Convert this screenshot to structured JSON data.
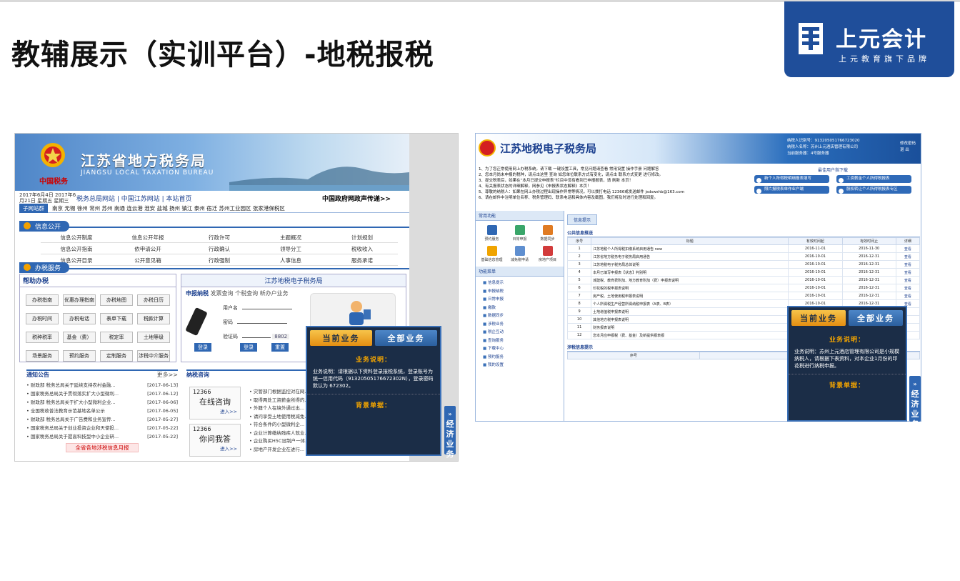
{
  "slide": {
    "title": "教辅展示（实训平台）-地税报税",
    "logo_brand": "上元会计",
    "logo_sub": "上元教育旗下品牌"
  },
  "left_site": {
    "header_cn": "江苏省地方税务局",
    "header_en": "JIANGSU LOCAL TAXATION BUREAU",
    "emblem_caption": "中国税务",
    "date_line": "2017年6月4日 2017年6月21日 星期五 星期三",
    "nav_links": "税务总局网站 | 中国江苏网站 | 本站首页",
    "nav_right": "中国政府网政声传递>>",
    "subnav_tag": "子网站群",
    "subnav_items": "南京  无锡  徐州  常州  苏州  南通  连云港  淮安  盐城  扬州  镇江  泰州  宿迁    苏州工业园区    张家港保税区",
    "info_title": "信息公开",
    "info_items": [
      "信息公开制度",
      "信息公开年报",
      "行政许可",
      "主题概况",
      "计划规划",
      "信息公开指南",
      "依申请公开",
      "行政确认",
      "领导分工",
      "税收收入",
      "信息公开目录",
      "公开意见箱",
      "行政强制",
      "人事信息",
      "服务承诺"
    ],
    "service_title": "办税服务",
    "help_title": "帮助办税",
    "help_buttons": [
      "办税指南",
      "优惠办理指南",
      "办税地图",
      "办税日历",
      "办税时间",
      "办税电话",
      "表单下载",
      "税款计算",
      "税种税率",
      "基金（费）",
      "税定率",
      "土地等级",
      "场景服务",
      "预约服务",
      "定制服务",
      "涉税中介服务"
    ],
    "login_title": "江苏地税电子税务局",
    "login_tabs": [
      "申报纳税",
      "发票查询",
      "个税查询",
      "新办户业务"
    ],
    "user_label": "用户名",
    "pwd_label": "密码",
    "captcha_label": "验证码",
    "captcha_value": "8802",
    "login_btn": "登录",
    "reset_btn": "重置",
    "cert_btn": "登录",
    "notice_title": "通知公告",
    "notice_more": "更多>>",
    "notices": [
      {
        "t": "• 财政部 税务总局关于延续支持农村金融...",
        "d": "[2017-06-13]"
      },
      {
        "t": "• 国家税务总局关于贯彻落实扩大小型微利...",
        "d": "[2017-06-12]"
      },
      {
        "t": "• 财政部 税务总局关于扩大小型微利企业...",
        "d": "[2017-06-06]"
      },
      {
        "t": "• 全国税收普法教育示范基地名单公示",
        "d": "[2017-06-05]"
      },
      {
        "t": "• 财政部 税务总局关于广告费和业务宣传...",
        "d": "[2017-05-27]"
      },
      {
        "t": "• 国家税务总局关于创业投资企业和天使投...",
        "d": "[2017-05-22]"
      },
      {
        "t": "• 国家税务总局关于提高科技型中小企业研...",
        "d": "[2017-05-22]"
      }
    ],
    "notice_footer": "全省各地涉税信息月报",
    "consult_title": "纳税咨询",
    "consult_box1_num": "12366",
    "consult_box1_text": "在线咨询",
    "consult_box2_num": "12366",
    "consult_box2_text": "你问我答",
    "consult_enter": "进入>>",
    "consult_items": [
      "• 灾管部门根据监控对在网...",
      "• 取得两处工资薪金所得的...",
      "• 外籍个人在境外通过出...",
      "• 请问享受土地使用税减免...",
      "• 符合条件的小型微利企...",
      "• 企业计算缴纳残疾人就业...",
      "• 企业购买H5C设制户一体...",
      "• 房地产开发企业在进行..."
    ]
  },
  "popup_left": {
    "tab_current": "当前业务",
    "tab_all": "全部业务",
    "desc_title": "业务说明：",
    "desc_body": "业务说明：请根据以下资料登录报税系统，登录账号为统一信用代码（91320505176672302N），登录密码默认为 672302。",
    "bg_title": "背景单据："
  },
  "side_tab": "经济业务",
  "right_site": {
    "header": "江苏地税电子税务局",
    "acct_lines": [
      "纳税人识别号：913205051766723020",
      "纳税人名称：苏州上元酒店管理有限公司",
      "当前服务器：4号服务器"
    ],
    "acct_links": [
      "修改密码",
      "退 出"
    ],
    "tips": [
      "1、为了您正常使用网上办税系统，请下载 一键设置工具，常见问题请查看 常用设置 操作手册 问题解答",
      "2、您本月尚未申报的税种，请点击这里 查询    如您单位联系方式有变化，请点击 联系方式变更 进行修改。",
      "3、提交税表后，如果在“本月已提交申报表”栏目中没有看到已申报报表，请 刷新 本页！",
      "4、有关报表状态的详细解释，网参见《申报表状态解释》本页！",
      "5、尊敬的纳税人：如果在网上办税过程出现操作异常等情况，可以拨打电话 12366或发送邮件 jsdswshb@163.com",
      "6、请在邮件中注明单位名称、税务管理码、联系电话和具体内容及截图，我们将及时进行处理和回复。"
    ],
    "guide_title": "最佳用户指下载",
    "guide_items": [
      "新个人所得税明细报表填写",
      "工资薪金个人所得税报表",
      "照片报税表单作业户端",
      "股权转让个人所得税报表专区"
    ],
    "left_menu_title": "常用功能",
    "left_icons": [
      "预约服务",
      "日常申报",
      "数据同步",
      "基础信息管理",
      "减免税申请",
      "房地产项目"
    ],
    "menu_title": "功能菜单",
    "menu_items": [
      "信息提示",
      "申报纳税",
      "日常申报",
      "缴款",
      "数据同步",
      "涉税业务",
      "税企互动",
      "查询服务",
      "下载中心",
      "预约服务",
      "我的设置"
    ],
    "tab_label": "信息提示",
    "public_title": "公共信息推送",
    "headers": [
      "序号",
      "标题",
      "有效时间起",
      "有效时间止",
      "详细"
    ],
    "rows": [
      [
        "1",
        "江苏地税个人所得税扣缴系统启用通告 new",
        "2016-11-01",
        "2016-11-30",
        "查看"
      ],
      [
        "2",
        "江苏省地方税务电子税务局启用通告",
        "2016-10-01",
        "2016-12-31",
        "查看"
      ],
      [
        "3",
        "江苏地税电子税务局总体说明",
        "2016-10-01",
        "2016-12-31",
        "查看"
      ],
      [
        "4",
        "本月已填写申报表【状态】判别明",
        "2016-10-01",
        "2016-12-31",
        "查看"
      ],
      [
        "5",
        "城建税、教育费附加、地方教育附加（费）申报表说明",
        "2016-10-01",
        "2016-12-31",
        "查看"
      ],
      [
        "6",
        "印花税的税申报表说明",
        "2016-10-01",
        "2016-12-31",
        "查看"
      ],
      [
        "7",
        "房产税、土地使用税申报表说明",
        "2016-10-01",
        "2016-12-31",
        "查看"
      ],
      [
        "8",
        "个人所得税生产经营所得纳税申报表（A表、B表）",
        "2016-10-01",
        "2016-12-31",
        "查看"
      ],
      [
        "9",
        "土地增值税申报表说明",
        "",
        "",
        ""
      ],
      [
        "10",
        "其他地方税申报表说明",
        "",
        "",
        ""
      ],
      [
        "11",
        "财务报表说明",
        "",
        "",
        ""
      ],
      [
        "12",
        "您本月应申报税（费、基金）及新提供报表报",
        "",
        "",
        ""
      ]
    ],
    "tax_title": "涉税信息提示",
    "tax_headers": [
      "序号",
      "事项标题"
    ]
  },
  "popup_right": {
    "tab_current": "当前业务",
    "tab_all": "全部业务",
    "desc_title": "业务说明：",
    "desc_body": "业务说明：苏州上元酒店管理有限公司是小规模纳税人，请根据下表资料，对本企业1月份的印花税进行纳税申报。",
    "bg_title": "背景单据："
  }
}
